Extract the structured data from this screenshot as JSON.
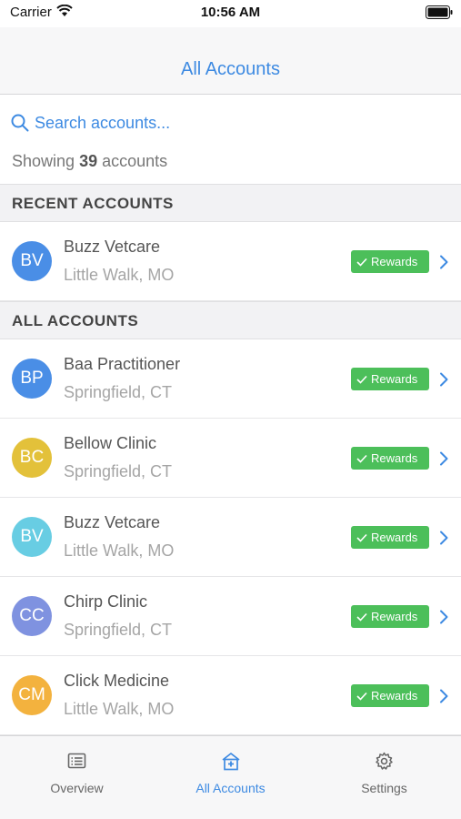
{
  "status_bar": {
    "carrier": "Carrier",
    "time": "10:56 AM"
  },
  "nav": {
    "title": "All Accounts"
  },
  "search": {
    "placeholder": "Search accounts..."
  },
  "summary": {
    "prefix": "Showing",
    "count": "39",
    "suffix": "accounts"
  },
  "sections": {
    "recent": "RECENT ACCOUNTS",
    "all": "ALL ACCOUNTS"
  },
  "recent_accounts": [
    {
      "initials": "BV",
      "name": "Buzz Vetcare",
      "location": "Little Walk, MO",
      "badge": "Rewards",
      "color": "#4a8ee6"
    }
  ],
  "all_accounts": [
    {
      "initials": "BP",
      "name": "Baa Practitioner",
      "location": "Springfield, CT",
      "badge": "Rewards",
      "color": "#4a8ee6"
    },
    {
      "initials": "BC",
      "name": "Bellow Clinic",
      "location": "Springfield, CT",
      "badge": "Rewards",
      "color": "#e3c13a"
    },
    {
      "initials": "BV",
      "name": "Buzz Vetcare",
      "location": "Little Walk, MO",
      "badge": "Rewards",
      "color": "#68cde3"
    },
    {
      "initials": "CC",
      "name": "Chirp Clinic",
      "location": "Springfield, CT",
      "badge": "Rewards",
      "color": "#7f92e0"
    },
    {
      "initials": "CM",
      "name": "Click Medicine",
      "location": "Little Walk, MO",
      "badge": "Rewards",
      "color": "#f3b23e"
    }
  ],
  "tabs": [
    {
      "label": "Overview",
      "icon": "list-icon",
      "active": false
    },
    {
      "label": "All Accounts",
      "icon": "building-plus-icon",
      "active": true
    },
    {
      "label": "Settings",
      "icon": "gear-icon",
      "active": false
    }
  ],
  "colors": {
    "accent": "#3d8ae2",
    "rewards_green": "#4cbf5a"
  }
}
